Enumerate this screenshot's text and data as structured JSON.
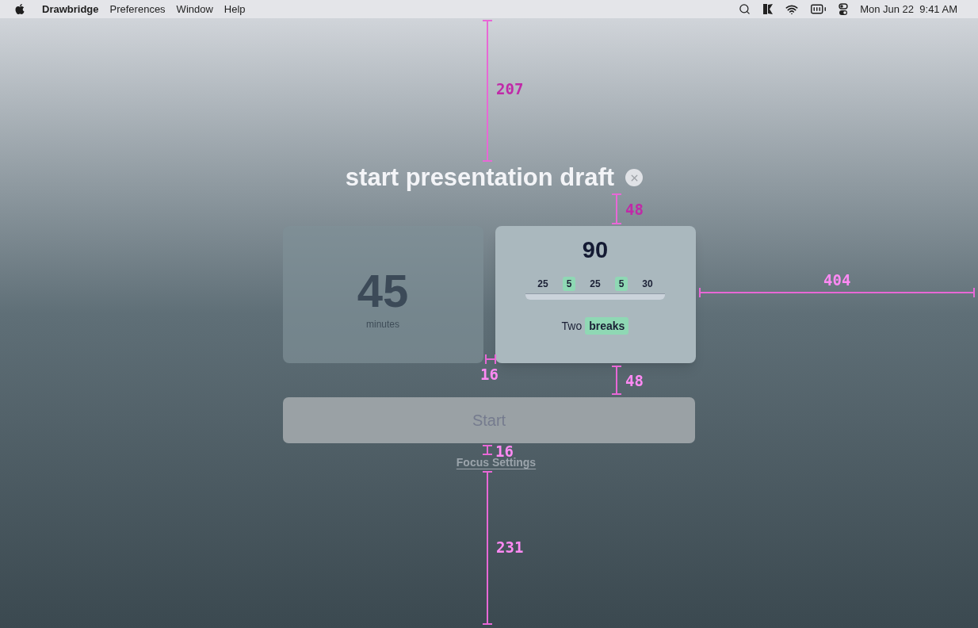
{
  "menu_bar": {
    "app_name": "Drawbridge",
    "menus": [
      "Preferences",
      "Window",
      "Help"
    ],
    "clock": "Mon Jun 22  9:41 AM"
  },
  "session": {
    "title": "start presentation draft"
  },
  "options": [
    {
      "kind": "single",
      "selected": false,
      "total": "45",
      "caption": "minutes"
    },
    {
      "kind": "split",
      "selected": true,
      "total": "90",
      "segments": [
        {
          "kind": "work",
          "label": "25"
        },
        {
          "kind": "break",
          "label": "5"
        },
        {
          "kind": "work",
          "label": "25"
        },
        {
          "kind": "break",
          "label": "5"
        },
        {
          "kind": "work",
          "label": "30"
        }
      ],
      "summary_prefix": "Two",
      "summary_highlight": "breaks"
    }
  ],
  "start_button": {
    "label": "Start",
    "disabled": true
  },
  "settings_link": "Focus Settings",
  "annotations": [
    {
      "label": "207"
    },
    {
      "label": "48"
    },
    {
      "label": "404"
    },
    {
      "label": "16"
    },
    {
      "label": "48"
    },
    {
      "label": "16"
    },
    {
      "label": "231"
    }
  ]
}
